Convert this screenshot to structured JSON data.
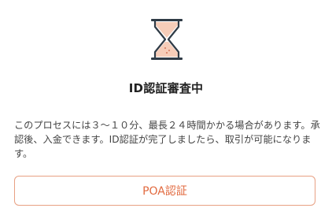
{
  "status": {
    "icon": "hourglass-icon",
    "title": "ID認証審査中",
    "description": "このプロセスには３～１０分、最長２４時間かかる場合があります。承認後、入金できます。ID認証が完了しましたら、取引が可能になります。"
  },
  "actions": {
    "poa_label": "POA認証"
  },
  "colors": {
    "accent": "#e26a3f",
    "button_border": "#e8a083",
    "hourglass_frame": "#2f3b46",
    "hourglass_sand": "#f6cdb9"
  }
}
